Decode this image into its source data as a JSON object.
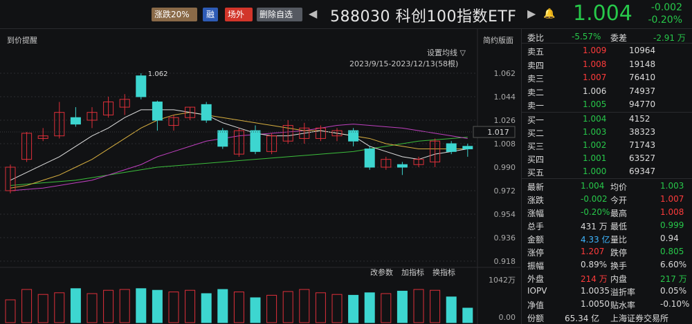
{
  "toolbar": {
    "tag_zd": "涨跌20%",
    "tag_rong": "融",
    "tag_cw": "场外",
    "tag_del": "删除自选",
    "nav_prev": "◀",
    "nav_next": "▶",
    "title": "588030  科创100指数ETF",
    "price": "1.004",
    "change": "-0.002",
    "change_pct": "-0.20%"
  },
  "chart_header": {
    "left": "到价提醒",
    "right": "简约版面",
    "ma_setting": "设置均线 ▽",
    "range": "2023/9/15-2023/12/13(58根)"
  },
  "price_axis": [
    "1.062",
    "1.044",
    "1.026",
    "1.008",
    "0.990",
    "0.972",
    "0.954",
    "0.936",
    "0.918"
  ],
  "current_line_label": "1.017",
  "high_label": "1.062",
  "volume_header": {
    "edit": "改参数",
    "add": "加指标",
    "switch": "换指标"
  },
  "volume_axis": [
    "1042万",
    "0.00"
  ],
  "chart_data": {
    "type": "candlestick",
    "candles": [
      {
        "o": 0.972,
        "c": 0.99,
        "h": 0.992,
        "l": 0.97
      },
      {
        "o": 0.996,
        "c": 1.016,
        "h": 1.017,
        "l": 0.994
      },
      {
        "o": 1.012,
        "c": 1.014,
        "h": 1.02,
        "l": 1.01
      },
      {
        "o": 1.014,
        "c": 1.032,
        "h": 1.04,
        "l": 1.012
      },
      {
        "o": 1.028,
        "c": 1.023,
        "h": 1.036,
        "l": 1.021
      },
      {
        "o": 1.026,
        "c": 1.032,
        "h": 1.036,
        "l": 1.02
      },
      {
        "o": 1.03,
        "c": 1.04,
        "h": 1.044,
        "l": 1.028
      },
      {
        "o": 1.036,
        "c": 1.042,
        "h": 1.046,
        "l": 1.03
      },
      {
        "o": 1.06,
        "c": 1.044,
        "h": 1.062,
        "l": 1.042
      },
      {
        "o": 1.04,
        "c": 1.026,
        "h": 1.041,
        "l": 1.018
      },
      {
        "o": 1.022,
        "c": 1.028,
        "h": 1.03,
        "l": 1.018
      },
      {
        "o": 1.028,
        "c": 1.036,
        "h": 1.036,
        "l": 1.026
      },
      {
        "o": 1.038,
        "c": 1.026,
        "h": 1.04,
        "l": 1.024
      },
      {
        "o": 1.018,
        "c": 1.006,
        "h": 1.02,
        "l": 1.004
      },
      {
        "o": 1.0,
        "c": 1.018,
        "h": 1.02,
        "l": 0.998
      },
      {
        "o": 1.018,
        "c": 1.002,
        "h": 1.022,
        "l": 1.0
      },
      {
        "o": 1.002,
        "c": 1.014,
        "h": 1.016,
        "l": 1.0
      },
      {
        "o": 1.01,
        "c": 1.022,
        "h": 1.026,
        "l": 1.008
      },
      {
        "o": 1.012,
        "c": 1.02,
        "h": 1.024,
        "l": 1.008
      },
      {
        "o": 1.012,
        "c": 1.02,
        "h": 1.022,
        "l": 1.01
      },
      {
        "o": 1.014,
        "c": 1.018,
        "h": 1.02,
        "l": 1.01
      },
      {
        "o": 1.018,
        "c": 1.01,
        "h": 1.02,
        "l": 1.006
      },
      {
        "o": 1.004,
        "c": 0.99,
        "h": 1.006,
        "l": 0.988
      },
      {
        "o": 0.99,
        "c": 0.996,
        "h": 0.998,
        "l": 0.988
      },
      {
        "o": 0.992,
        "c": 0.99,
        "h": 0.994,
        "l": 0.984
      },
      {
        "o": 0.992,
        "c": 0.996,
        "h": 0.998,
        "l": 0.99
      },
      {
        "o": 0.994,
        "c": 1.01,
        "h": 1.012,
        "l": 0.99
      },
      {
        "o": 1.008,
        "c": 1.002,
        "h": 1.01,
        "l": 1.0
      },
      {
        "o": 1.006,
        "c": 1.004,
        "h": 1.008,
        "l": 0.998
      }
    ],
    "ma_white": [
      0.98,
      0.986,
      0.992,
      0.998,
      1.006,
      1.014,
      1.02,
      1.028,
      1.034,
      1.034,
      1.034,
      1.032,
      1.03,
      1.024,
      1.02,
      1.016,
      1.014,
      1.014,
      1.016,
      1.018,
      1.016,
      1.014,
      1.006,
      1.002,
      0.998,
      0.996,
      1.0,
      1.002,
      1.004
    ],
    "ma_yellow": [
      0.974,
      0.976,
      0.98,
      0.984,
      0.99,
      0.996,
      1.004,
      1.012,
      1.02,
      1.026,
      1.03,
      1.032,
      1.03,
      1.028,
      1.026,
      1.024,
      1.022,
      1.02,
      1.018,
      1.018,
      1.016,
      1.014,
      1.012,
      1.008,
      1.006,
      1.004,
      1.004,
      1.004,
      1.004
    ],
    "ma_magenta": [
      0.972,
      0.973,
      0.974,
      0.976,
      0.978,
      0.98,
      0.984,
      0.988,
      0.992,
      0.998,
      1.002,
      1.006,
      1.01,
      1.012,
      1.014,
      1.015,
      1.016,
      1.017,
      1.018,
      1.02,
      1.022,
      1.023,
      1.022,
      1.021,
      1.02,
      1.018,
      1.016,
      1.014,
      1.012
    ],
    "ma_green": [
      0.976,
      0.977,
      0.978,
      0.979,
      0.98,
      0.982,
      0.984,
      0.986,
      0.988,
      0.99,
      0.991,
      0.992,
      0.993,
      0.994,
      0.995,
      0.996,
      0.997,
      0.998,
      0.999,
      1.0,
      1.001,
      1.002,
      1.004,
      1.006,
      1.008,
      1.01,
      1.011,
      1.012,
      1.013
    ],
    "volumes": [
      0.55,
      0.8,
      0.68,
      0.72,
      0.82,
      0.7,
      0.78,
      0.8,
      0.82,
      0.78,
      0.74,
      0.78,
      0.7,
      0.8,
      0.74,
      0.6,
      0.66,
      0.75,
      0.8,
      0.72,
      0.68,
      0.66,
      0.72,
      0.7,
      0.76,
      0.8,
      0.78,
      0.62,
      0.35
    ]
  },
  "orderbook": {
    "webi_label": "委比",
    "webi": "-5.57%",
    "weicha_label": "委差",
    "weicha": "-2.91 万",
    "sells": [
      {
        "label": "卖五",
        "price": "1.009",
        "vol": "10964"
      },
      {
        "label": "卖四",
        "price": "1.008",
        "vol": "19148"
      },
      {
        "label": "卖三",
        "price": "1.007",
        "vol": "76410"
      },
      {
        "label": "卖二",
        "price": "1.006",
        "vol": "74937"
      },
      {
        "label": "卖一",
        "price": "1.005",
        "vol": "94770"
      }
    ],
    "buys": [
      {
        "label": "买一",
        "price": "1.004",
        "vol": "4152"
      },
      {
        "label": "买二",
        "price": "1.003",
        "vol": "38323"
      },
      {
        "label": "买三",
        "price": "1.002",
        "vol": "71743"
      },
      {
        "label": "买四",
        "price": "1.001",
        "vol": "63527"
      },
      {
        "label": "买五",
        "price": "1.000",
        "vol": "69347"
      }
    ]
  },
  "stats": [
    {
      "l1": "最新",
      "v1": "1.004",
      "c1": "green",
      "l2": "均价",
      "v2": "1.003",
      "c2": "green"
    },
    {
      "l1": "涨跌",
      "v1": "-0.002",
      "c1": "green",
      "l2": "今开",
      "v2": "1.007",
      "c2": "red"
    },
    {
      "l1": "涨幅",
      "v1": "-0.20%",
      "c1": "green",
      "l2": "最高",
      "v2": "1.008",
      "c2": "red"
    },
    {
      "l1": "总手",
      "v1": "431 万",
      "c1": "white",
      "l2": "最低",
      "v2": "0.999",
      "c2": "green"
    },
    {
      "l1": "金额",
      "v1": "4.33 亿",
      "c1": "blue",
      "l2": "量比",
      "v2": "0.94",
      "c2": "white"
    },
    {
      "l1": "涨停",
      "v1": "1.207",
      "c1": "red",
      "l2": "跌停",
      "v2": "0.805",
      "c2": "green"
    },
    {
      "l1": "振幅",
      "v1": "0.89%",
      "c1": "white",
      "l2": "换手",
      "v2": "6.60%",
      "c2": "white"
    },
    {
      "l1": "外盘",
      "v1": "214 万",
      "c1": "red",
      "l2": "内盘",
      "v2": "217 万",
      "c2": "green"
    },
    {
      "l1": "IOPV",
      "v1": "1.0035",
      "c1": "white",
      "l2": "溢折率",
      "v2": "0.05%",
      "c2": "white"
    },
    {
      "l1": "净值",
      "v1": "1.0050",
      "c1": "white",
      "l2": "贴水率",
      "v2": "-0.10%",
      "c2": "white"
    },
    {
      "l1": "份额",
      "v1": "65.34 亿",
      "c1": "white",
      "l2": "上海证券交易所",
      "v2": "",
      "c2": "white"
    }
  ]
}
